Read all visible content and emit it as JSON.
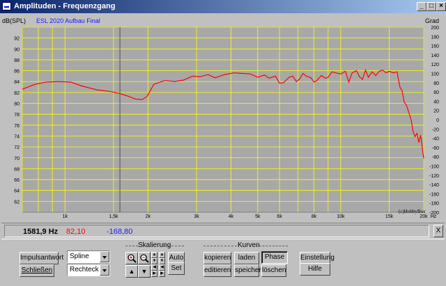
{
  "window": {
    "title": "Amplituden - Frequenzgang",
    "controls": [
      "minimize-icon",
      "restore-icon",
      "close-icon"
    ]
  },
  "plot": {
    "name": "ESL 2020 Aufbau Final",
    "y_unit": "dB(SPL)",
    "y2_unit": "Grad",
    "x_unit": "Hz",
    "copyright": "(c)HobbyBox",
    "cursor_freq_hz": 1581.9
  },
  "chart_data": {
    "type": "line",
    "x_scale": "log",
    "xlim": [
      700,
      20000
    ],
    "ylim": [
      60,
      94
    ],
    "y2lim": [
      -200,
      200
    ],
    "grid": true,
    "x_tick_labels": [
      {
        "v": 1000,
        "t": "1k"
      },
      {
        "v": 1500,
        "t": "1,5k"
      },
      {
        "v": 2000,
        "t": "2k"
      },
      {
        "v": 3000,
        "t": "3k"
      },
      {
        "v": 4000,
        "t": "4k"
      },
      {
        "v": 5000,
        "t": "5k"
      },
      {
        "v": 6000,
        "t": "6k"
      },
      {
        "v": 8000,
        "t": "8k"
      },
      {
        "v": 10000,
        "t": "10k"
      },
      {
        "v": 15000,
        "t": "15k"
      },
      {
        "v": 20000,
        "t": "20k"
      }
    ],
    "x_minor_grid": [
      700,
      800,
      900,
      1000,
      1500,
      2000,
      3000,
      4000,
      5000,
      6000,
      7000,
      8000,
      9000,
      10000,
      15000,
      20000
    ],
    "y_ticks": [
      62,
      64,
      66,
      68,
      70,
      72,
      74,
      76,
      78,
      80,
      82,
      84,
      86,
      88,
      90,
      92
    ],
    "y2_ticks": [
      200,
      180,
      160,
      140,
      120,
      100,
      80,
      60,
      40,
      20,
      0,
      -20,
      -40,
      -60,
      -80,
      -100,
      -120,
      -140,
      -160,
      -180,
      -200
    ],
    "series": [
      {
        "color": "#ff0000",
        "x": [
          700,
          780,
          850,
          950,
          1050,
          1150,
          1300,
          1450,
          1580,
          1700,
          1800,
          1900,
          1980,
          2100,
          2300,
          2500,
          2700,
          2900,
          3100,
          3300,
          3500,
          3800,
          4100,
          4400,
          4700,
          5000,
          5300,
          5500,
          5800,
          6000,
          6200,
          6500,
          6700,
          6900,
          7100,
          7300,
          7500,
          7800,
          8000,
          8200,
          8500,
          8800,
          9000,
          9300,
          9600,
          10000,
          10400,
          10700,
          11000,
          11400,
          11700,
          12000,
          12300,
          12600,
          13000,
          13400,
          13800,
          14200,
          14600,
          15000,
          15500,
          16000,
          16400,
          16700,
          17000,
          17300,
          17600,
          18000,
          18300,
          18600,
          18900,
          19200,
          19500,
          19800,
          20000
        ],
        "values": [
          82.6,
          83.5,
          83.9,
          84.0,
          83.9,
          83.2,
          82.5,
          82.2,
          81.8,
          81.3,
          80.8,
          80.7,
          81.2,
          83.5,
          84.2,
          84.0,
          84.3,
          85.0,
          84.9,
          85.3,
          84.7,
          85.3,
          85.6,
          85.5,
          85.4,
          84.8,
          85.2,
          84.6,
          85.0,
          83.7,
          83.8,
          84.8,
          85.0,
          84.0,
          84.5,
          85.5,
          85.0,
          84.7,
          83.9,
          84.2,
          85.1,
          84.6,
          84.8,
          85.8,
          85.6,
          85.4,
          85.9,
          83.9,
          85.6,
          86.0,
          84.9,
          84.4,
          86.1,
          84.8,
          85.8,
          85.1,
          85.9,
          86.1,
          85.6,
          85.9,
          85.6,
          85.8,
          83.0,
          82.3,
          80.2,
          79.7,
          78.6,
          77.0,
          74.9,
          73.9,
          74.5,
          72.8,
          74.2,
          71.5,
          69.9
        ]
      }
    ]
  },
  "status": {
    "frequency": "1581,9 Hz",
    "amplitude": "82,10",
    "phase": "-168,80",
    "close_x": "X"
  },
  "controls": {
    "impulse_button": "Impulsantwort",
    "close_button": "Schließen",
    "interp_select": "Spline",
    "window_select": "Rechteck",
    "scaling_group": "Skalierung",
    "auto_button": "Auto",
    "set_button": "Set",
    "curves_group": "Kurven",
    "copy_button": "kopieren",
    "load_button": "laden",
    "phase_button": "Phase",
    "edit_button": "editieren",
    "save_button": "speichern",
    "delete_button": "löschen",
    "settings_button": "Einstellung",
    "help_button": "Hilfe"
  }
}
